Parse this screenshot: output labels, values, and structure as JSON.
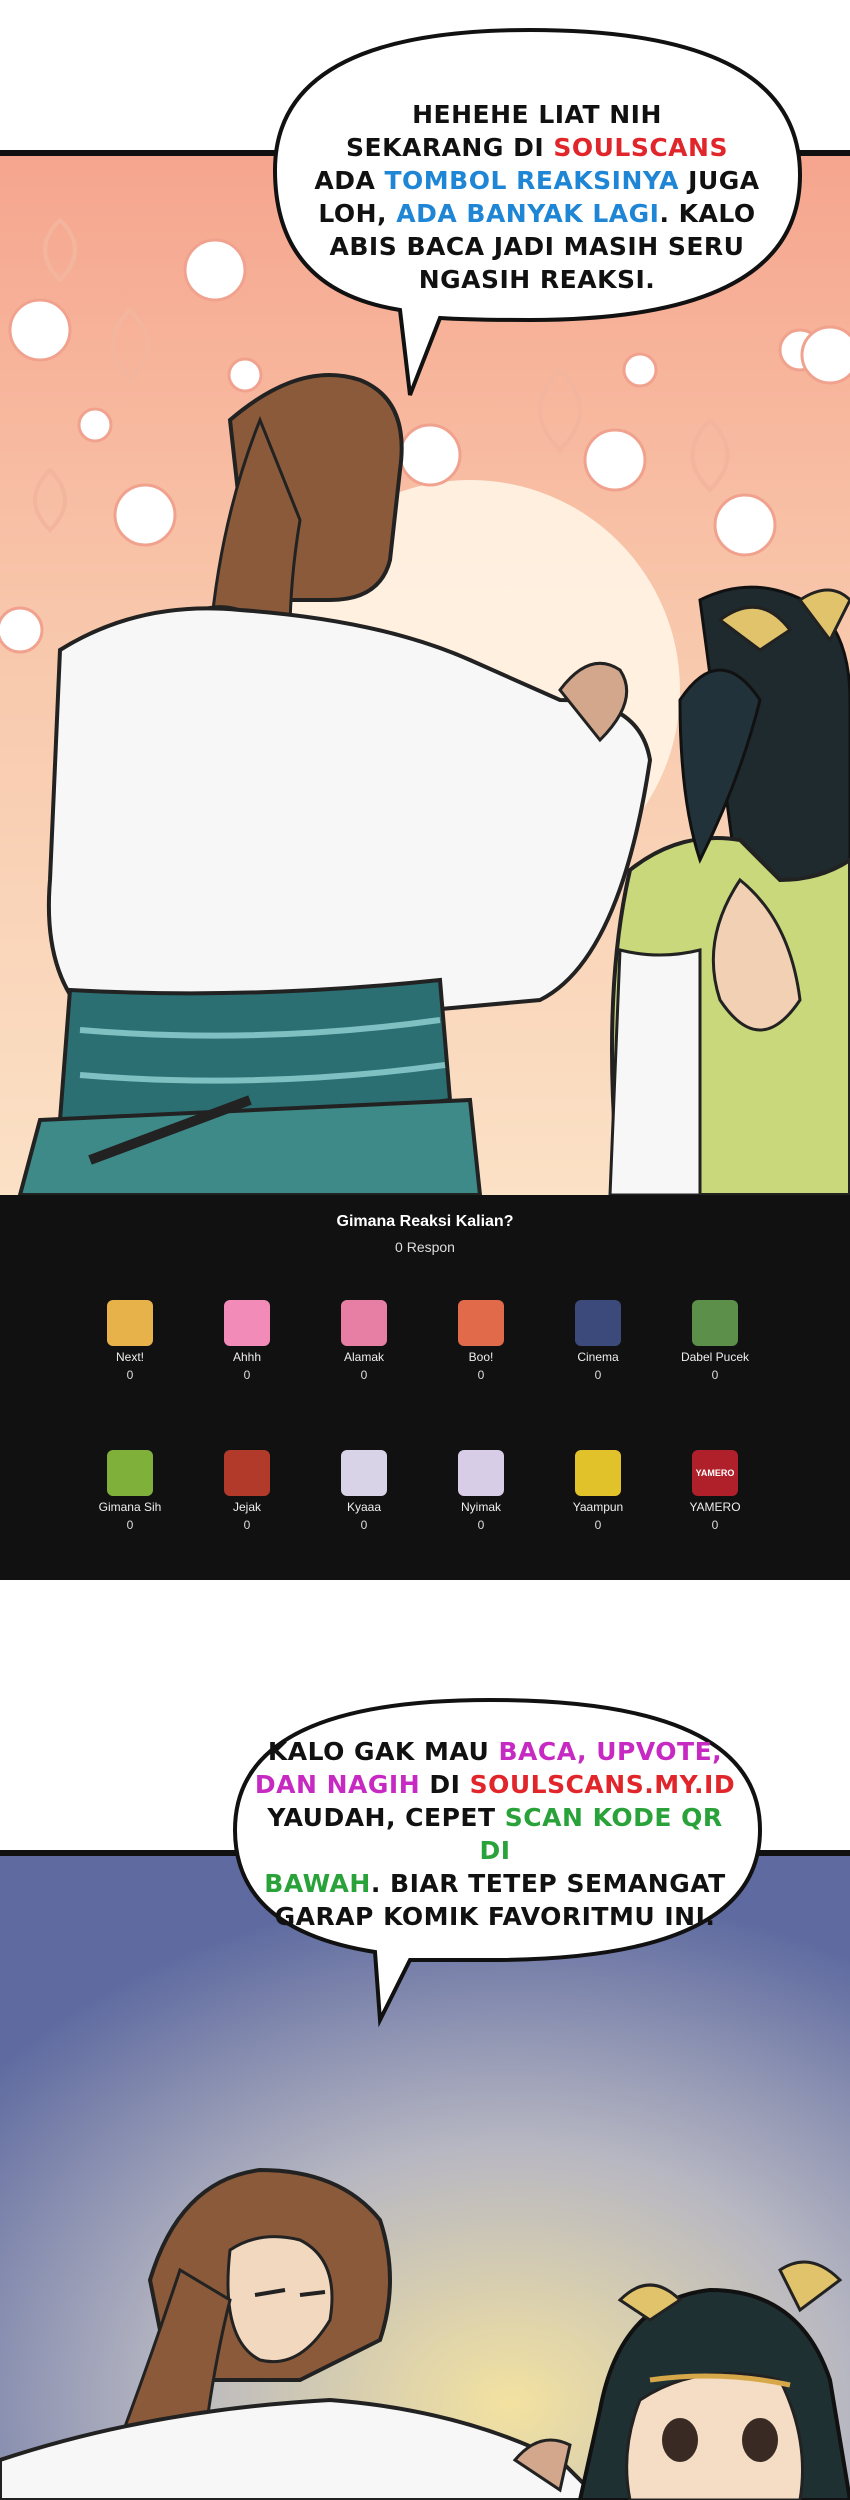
{
  "panel_top": {
    "bubble_lines": [
      [
        {
          "t": "HEHEHE LIAT NIH",
          "c": ""
        }
      ],
      [
        {
          "t": "SEKARANG DI ",
          "c": ""
        },
        {
          "t": "SOULSCANS",
          "c": "red"
        }
      ],
      [
        {
          "t": "ADA ",
          "c": ""
        },
        {
          "t": "TOMBOL REAKSINYA",
          "c": "blue"
        },
        {
          "t": " JUGA",
          "c": ""
        }
      ],
      [
        {
          "t": "LOH, ",
          "c": ""
        },
        {
          "t": "ADA BANYAK LAGI",
          "c": "blue"
        },
        {
          "t": ". KALO",
          "c": ""
        }
      ],
      [
        {
          "t": "ABIS BACA JADI MASIH SERU",
          "c": ""
        }
      ],
      [
        {
          "t": "NGASIH REAKSI.",
          "c": ""
        }
      ]
    ]
  },
  "reactions": {
    "title": "Gimana Reaksi Kalian?",
    "count_label": "0 Respon",
    "items": [
      {
        "label": "Next!",
        "count": "0",
        "icon": "hamster-icon",
        "color": "#e8b24a"
      },
      {
        "label": "Ahhh",
        "count": "0",
        "icon": "pink-blob-icon",
        "color": "#f28bb8"
      },
      {
        "label": "Alamak",
        "count": "0",
        "icon": "pink-hair-girl-icon",
        "color": "#e77fa5"
      },
      {
        "label": "Boo!",
        "count": "0",
        "icon": "starfish-icon",
        "color": "#e06a4a"
      },
      {
        "label": "Cinema",
        "count": "0",
        "icon": "dark-hair-character-icon",
        "color": "#3b4a7a"
      },
      {
        "label": "Dabel Pucek",
        "count": "0",
        "icon": "frog-icon",
        "color": "#5c8f4a"
      },
      {
        "label": "Gimana Sih",
        "count": "0",
        "icon": "green-face-icon",
        "color": "#7fb13a"
      },
      {
        "label": "Jejak",
        "count": "0",
        "icon": "footprints-icon",
        "color": "#b23a2a"
      },
      {
        "label": "Kyaaa",
        "count": "0",
        "icon": "crying-girl-icon",
        "color": "#d9d3e8"
      },
      {
        "label": "Nyimak",
        "count": "0",
        "icon": "white-hair-girl-icon",
        "color": "#d7cde6"
      },
      {
        "label": "Yaampun",
        "count": "0",
        "icon": "yellow-helmet-icon",
        "color": "#e2c22a"
      },
      {
        "label": "YAMERO",
        "count": "0",
        "icon": "yamero-icon",
        "color": "#b0202a",
        "icon_text": "YAMERO"
      }
    ]
  },
  "panel_bottom": {
    "bubble_lines": [
      [
        {
          "t": "KALO GAK MAU ",
          "c": ""
        },
        {
          "t": "BACA, UPVOTE,",
          "c": "magenta"
        }
      ],
      [
        {
          "t": "DAN NAGIH",
          "c": "magenta"
        },
        {
          "t": " DI ",
          "c": ""
        },
        {
          "t": "SOULSCANS.MY.ID",
          "c": "red"
        }
      ],
      [
        {
          "t": "YAUDAH, CEPET ",
          "c": ""
        },
        {
          "t": "SCAN KODE QR DI",
          "c": "green"
        }
      ],
      [
        {
          "t": "BAWAH",
          "c": "green"
        },
        {
          "t": ". BIAR TETEP SEMANGAT",
          "c": ""
        }
      ],
      [
        {
          "t": "GARAP KOMIK FAVORITMU INI.",
          "c": ""
        }
      ]
    ]
  }
}
